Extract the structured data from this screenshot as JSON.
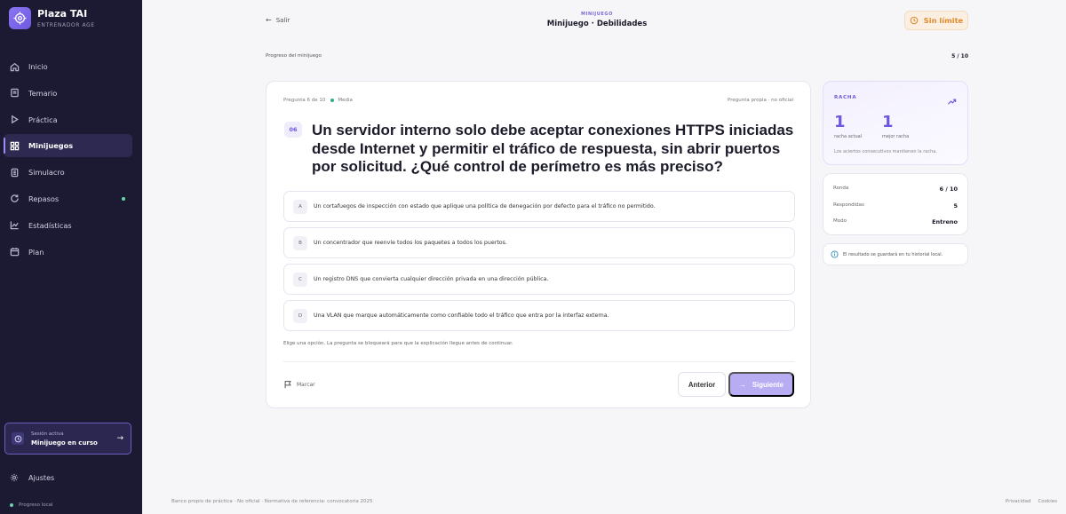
{
  "brand": {
    "title": "Plaza TAI",
    "subtitle": "ENTRENADOR AGE"
  },
  "nav": [
    {
      "label": "Inicio",
      "icon": "home-icon"
    },
    {
      "label": "Temario",
      "icon": "book-icon"
    },
    {
      "label": "Práctica",
      "icon": "play-icon"
    },
    {
      "label": "Minijuegos",
      "icon": "grid-icon",
      "active": true
    },
    {
      "label": "Simulacro",
      "icon": "document-icon"
    },
    {
      "label": "Repasos",
      "icon": "refresh-icon",
      "badge": true
    },
    {
      "label": "Estadísticas",
      "icon": "chart-icon"
    },
    {
      "label": "Plan",
      "icon": "calendar-icon"
    }
  ],
  "session": {
    "small": "Sesión activa",
    "main": "Minijuego en curso"
  },
  "settings_label": "Ajustes",
  "local_label": "Progreso local",
  "header": {
    "back_label": "Salir",
    "kicker": "MINIJUEGO",
    "title": "Minijuego · Debilidades",
    "limit_label": "Sin límite"
  },
  "progress": {
    "label": "Progreso del minijuego",
    "count": "5 / 10",
    "fraction": 0.5
  },
  "card": {
    "meta_question": "Pregunta 6 de 10",
    "meta_level": "Media",
    "meta_right": "Pregunta propia · no oficial",
    "number": "06",
    "question": "Un servidor interno solo debe aceptar conexiones HTTPS iniciadas desde Internet y permitir el tráfico de respuesta, sin abrir puertos por solicitud. ¿Qué control de perímetro es más preciso?",
    "options": [
      {
        "letter": "A",
        "text": "Un cortafuegos de inspección con estado que aplique una política de denegación por defecto para el tráfico no permitido."
      },
      {
        "letter": "B",
        "text": "Un concentrador que reenvíe todos los paquetes a todos los puertos."
      },
      {
        "letter": "C",
        "text": "Un registro DNS que convierta cualquier dirección privada en una dirección pública."
      },
      {
        "letter": "D",
        "text": "Una VLAN que marque automáticamente como confiable todo el tráfico que entra por la interfaz externa."
      }
    ],
    "hint": "Elige una opción. La pregunta se bloqueará para que la explicación llegue antes de continuar.",
    "mark_label": "Marcar",
    "prev_label": "Anterior",
    "next_label": "Siguiente"
  },
  "streak": {
    "title": "RACHA",
    "current": "1",
    "current_label": "racha actual",
    "best": "1",
    "best_label": "mejor racha",
    "note": "Los aciertos consecutivos mantienen la racha."
  },
  "stats": [
    {
      "key": "Ronda",
      "value": "6 / 10"
    },
    {
      "key": "Respondidas",
      "value": "5"
    },
    {
      "key": "Modo",
      "value": "Entreno"
    }
  ],
  "info_text": "El resultado se guardará en tu historial local.",
  "footer": {
    "left": "Banco propio de práctica · No oficial · Normativa de referencia: convocatoria 2025",
    "privacy": "Privacidad",
    "cookies": "Cookies"
  },
  "colors": {
    "sidebar": "#1c1a33",
    "accent": "#6e58e0",
    "limit": "#e08a2c",
    "success": "#67d7a6"
  }
}
